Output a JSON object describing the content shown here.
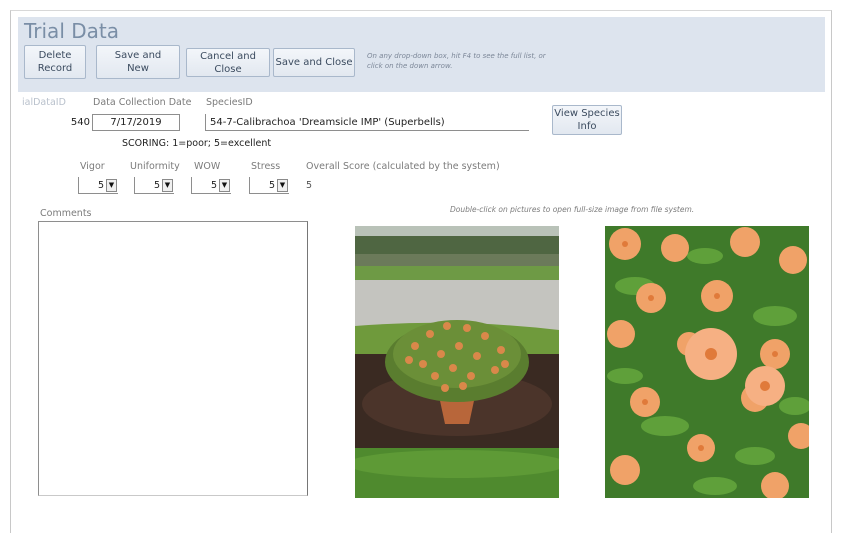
{
  "form": {
    "title": "Trial Data",
    "hint": "On any drop-down box, hit F4 to see the full list, or click on the down arrow."
  },
  "toolbar": {
    "delete_label": "Delete\nRecord",
    "save_new_label": "Save and\nNew",
    "cancel_close_label": "Cancel and Close",
    "save_close_label": "Save and Close"
  },
  "record": {
    "trial_id_label": "ialDataID",
    "trial_id": "540",
    "date_label": "Data Collection Date",
    "date": "7/17/2019",
    "species_label": "SpeciesID",
    "species": "54-7-Calibrachoa 'Dreamsicle IMP' (Superbells)",
    "view_species_label": "View Species\nInfo"
  },
  "scoring": {
    "legend": "SCORING: 1=poor; 5=excellent",
    "vigor_label": "Vigor",
    "vigor": "5",
    "uniformity_label": "Uniformity",
    "uniformity": "5",
    "wow_label": "WOW",
    "wow": "5",
    "stress_label": "Stress",
    "stress": "5",
    "overall_label": "Overall Score (calculated by the system)",
    "overall": "5"
  },
  "comments": {
    "label": "Comments",
    "value": ""
  },
  "pictures": {
    "hint": "Double-click on pictures to open full-size image from file system."
  },
  "icons": {
    "dropdown": "chevron-down-icon"
  }
}
